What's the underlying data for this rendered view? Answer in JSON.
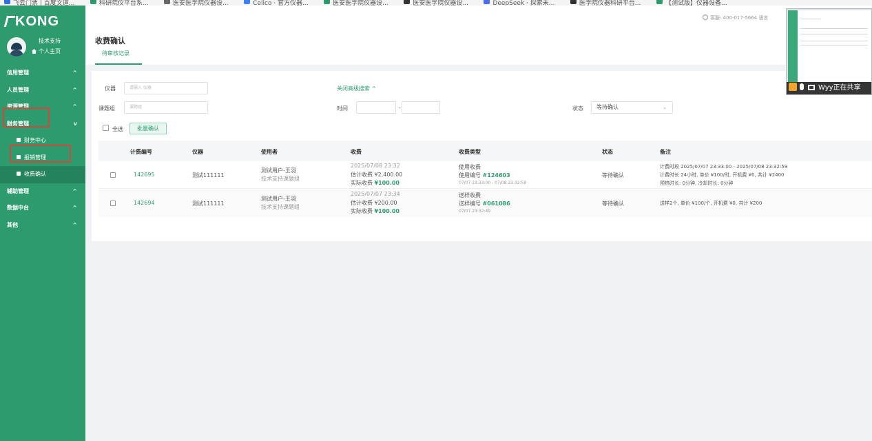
{
  "bookmarks": [
    {
      "label": "飞云门票 | 百度文道...",
      "color": "#2f6fe0"
    },
    {
      "label": "科研院仪平台系...",
      "color": "#2e9b6f"
    },
    {
      "label": "医安医学院仪器设...",
      "color": "#666666"
    },
    {
      "label": "Celico · 官方仪器...",
      "color": "#3b82f6"
    },
    {
      "label": "医安医学院仪器设...",
      "color": "#2e9b6f"
    },
    {
      "label": "医安医学院仪器设...",
      "color": "#333333"
    },
    {
      "label": "DeepSeek · 探索未...",
      "color": "#4f6bed"
    },
    {
      "label": "医学院仪器科研平台...",
      "color": "#333333"
    },
    {
      "label": "【测试版】仪器设备...",
      "color": "#2e9b6f"
    }
  ],
  "sidebar": {
    "logo": "KONG",
    "user_name": "技术支持",
    "home_label": "个人主页",
    "menu": [
      {
        "label": "信用管理",
        "chev": "^"
      },
      {
        "label": "人员管理",
        "chev": "^"
      },
      {
        "label": "资源管理",
        "chev": "^"
      },
      {
        "label": "财务管理",
        "chev": "v"
      }
    ],
    "submenu": [
      {
        "label": "财务中心"
      },
      {
        "label": "报销管理"
      },
      {
        "label": "收费确认"
      }
    ],
    "menu2": [
      {
        "label": "辅助管理",
        "chev": "^"
      },
      {
        "label": "数据中台",
        "chev": "^"
      },
      {
        "label": "其他",
        "chev": "^"
      }
    ]
  },
  "topbar": {
    "service_text": "客服: 400-017-5664 语言"
  },
  "share": {
    "text": "Wyy正在共享"
  },
  "page": {
    "title": "收费确认",
    "tab_label": "待审核记录"
  },
  "filters": {
    "instrument_label": "仪器",
    "instrument_placeholder": "请输入 仪器",
    "group_label": "课题组",
    "group_placeholder": "课题组",
    "toggle_search": "关闭高级搜索",
    "time_label": "时间",
    "time_sep": "-",
    "status_label": "状态",
    "status_value": "等待确认",
    "select_all": "全选",
    "batch_confirm": "批量确认"
  },
  "table": {
    "headers": [
      "计费编号",
      "仪器",
      "使用者",
      "收费",
      "收费类型",
      "状态",
      "备注"
    ],
    "rows": [
      {
        "id": "142695",
        "instrument": "测试111111",
        "user_name": "测试用户-王羽",
        "user_group": "技术支持课题组",
        "fee_time": "2025/07/08 23:32",
        "fee_est": "估计收费 ¥2,400.00",
        "fee_actual_label": "实际收费",
        "fee_actual": "¥100.00",
        "type_name": "使用收费",
        "type_code_label": "使用编号",
        "type_code": "#124603",
        "type_range": "07/07 23:33:00 - 07/08 23:32:59",
        "status": "等待确认",
        "note_line1": "计费时段 2025/07/07 23:33:00 - 2025/07/08 23:32:59",
        "note_line2": "计费时长 24小时, 单价 ¥100/时, 开机费 ¥0, 共计 ¥2400",
        "note_line3": "预热时长: 0分钟, 冷却时长: 0分钟"
      },
      {
        "id": "142694",
        "instrument": "测试111111",
        "user_name": "测试用户-王羽",
        "user_group": "技术支持课题组",
        "fee_time": "2025/07/07 23:34",
        "fee_est": "估计收费 ¥200.00",
        "fee_actual_label": "实际收费",
        "fee_actual": "¥100.00",
        "type_name": "送样收费",
        "type_code_label": "送样编号",
        "type_code": "#061086",
        "type_range": "07/07 23:32:49",
        "status": "等待确认",
        "note_line1": "送样2个, 单价 ¥100/个, 开机费 ¥0, 共计 ¥200",
        "note_line2": "",
        "note_line3": ""
      }
    ]
  }
}
